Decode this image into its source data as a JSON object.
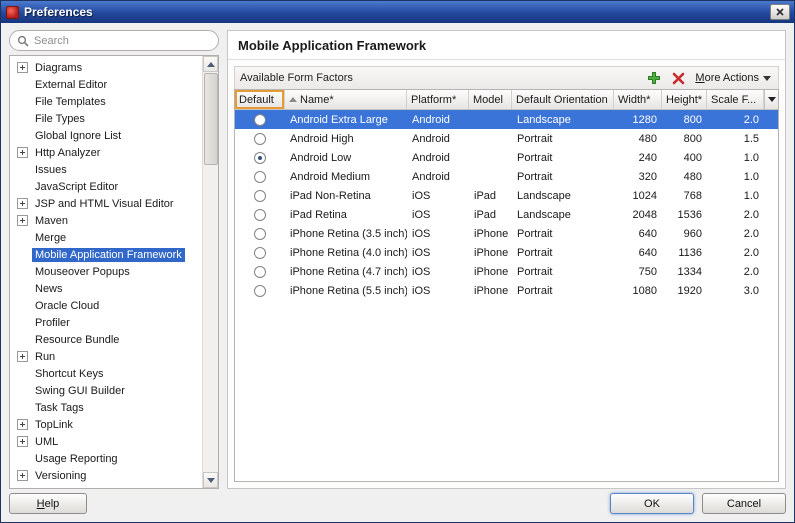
{
  "window": {
    "title": "Preferences"
  },
  "sidebar": {
    "search_placeholder": "Search",
    "items": [
      {
        "label": "Diagrams",
        "exp": true
      },
      {
        "label": "External Editor",
        "exp": false
      },
      {
        "label": "File Templates",
        "exp": false
      },
      {
        "label": "File Types",
        "exp": false
      },
      {
        "label": "Global Ignore List",
        "exp": false
      },
      {
        "label": "Http Analyzer",
        "exp": true
      },
      {
        "label": "Issues",
        "exp": false
      },
      {
        "label": "JavaScript Editor",
        "exp": false
      },
      {
        "label": "JSP and HTML Visual Editor",
        "exp": true
      },
      {
        "label": "Maven",
        "exp": true
      },
      {
        "label": "Merge",
        "exp": false
      },
      {
        "label": "Mobile Application Framework",
        "exp": false,
        "selected": true
      },
      {
        "label": "Mouseover Popups",
        "exp": false
      },
      {
        "label": "News",
        "exp": false
      },
      {
        "label": "Oracle Cloud",
        "exp": false
      },
      {
        "label": "Profiler",
        "exp": false
      },
      {
        "label": "Resource Bundle",
        "exp": false
      },
      {
        "label": "Run",
        "exp": true
      },
      {
        "label": "Shortcut Keys",
        "exp": false
      },
      {
        "label": "Swing GUI Builder",
        "exp": false
      },
      {
        "label": "Task Tags",
        "exp": false
      },
      {
        "label": "TopLink",
        "exp": true
      },
      {
        "label": "UML",
        "exp": true
      },
      {
        "label": "Usage Reporting",
        "exp": false
      },
      {
        "label": "Versioning",
        "exp": true
      }
    ]
  },
  "main": {
    "title": "Mobile Application Framework",
    "toolbar": {
      "label": "Available Form Factors",
      "more_actions": "More Actions"
    },
    "table": {
      "columns": [
        {
          "label": "Default"
        },
        {
          "label": "Name*",
          "sorted": "asc"
        },
        {
          "label": "Platform*"
        },
        {
          "label": "Model"
        },
        {
          "label": "Default Orientation"
        },
        {
          "label": "Width*"
        },
        {
          "label": "Height*"
        },
        {
          "label": "Scale F..."
        }
      ],
      "rows": [
        {
          "default": false,
          "selected": true,
          "name": "Android Extra Large",
          "platform": "Android",
          "model": "",
          "orientation": "Landscape",
          "width": "1280",
          "height": "800",
          "scale": "2.0"
        },
        {
          "default": false,
          "name": "Android High",
          "platform": "Android",
          "model": "",
          "orientation": "Portrait",
          "width": "480",
          "height": "800",
          "scale": "1.5"
        },
        {
          "default": true,
          "name": "Android Low",
          "platform": "Android",
          "model": "",
          "orientation": "Portrait",
          "width": "240",
          "height": "400",
          "scale": "1.0"
        },
        {
          "default": false,
          "name": "Android Medium",
          "platform": "Android",
          "model": "",
          "orientation": "Portrait",
          "width": "320",
          "height": "480",
          "scale": "1.0"
        },
        {
          "default": false,
          "name": "iPad Non-Retina",
          "platform": "iOS",
          "model": "iPad",
          "orientation": "Landscape",
          "width": "1024",
          "height": "768",
          "scale": "1.0"
        },
        {
          "default": false,
          "name": "iPad Retina",
          "platform": "iOS",
          "model": "iPad",
          "orientation": "Landscape",
          "width": "2048",
          "height": "1536",
          "scale": "2.0"
        },
        {
          "default": false,
          "name": "iPhone Retina (3.5 inch)",
          "platform": "iOS",
          "model": "iPhone",
          "orientation": "Portrait",
          "width": "640",
          "height": "960",
          "scale": "2.0"
        },
        {
          "default": false,
          "name": "iPhone Retina (4.0 inch)",
          "platform": "iOS",
          "model": "iPhone",
          "orientation": "Portrait",
          "width": "640",
          "height": "1136",
          "scale": "2.0"
        },
        {
          "default": false,
          "name": "iPhone Retina (4.7 inch)",
          "platform": "iOS",
          "model": "iPhone",
          "orientation": "Portrait",
          "width": "750",
          "height": "1334",
          "scale": "2.0"
        },
        {
          "default": false,
          "name": "iPhone Retina (5.5 inch)",
          "platform": "iOS",
          "model": "iPhone",
          "orientation": "Portrait",
          "width": "1080",
          "height": "1920",
          "scale": "3.0"
        }
      ]
    }
  },
  "footer": {
    "help": "Help",
    "ok": "OK",
    "cancel": "Cancel"
  },
  "colors": {
    "selection": "#3b74d9",
    "focus_orange": "#e59b36",
    "add_green": "#3fa03a",
    "delete_red": "#cc2b2b",
    "titlebar_top": "#4a7ad0",
    "titlebar_bottom": "#16367f"
  }
}
